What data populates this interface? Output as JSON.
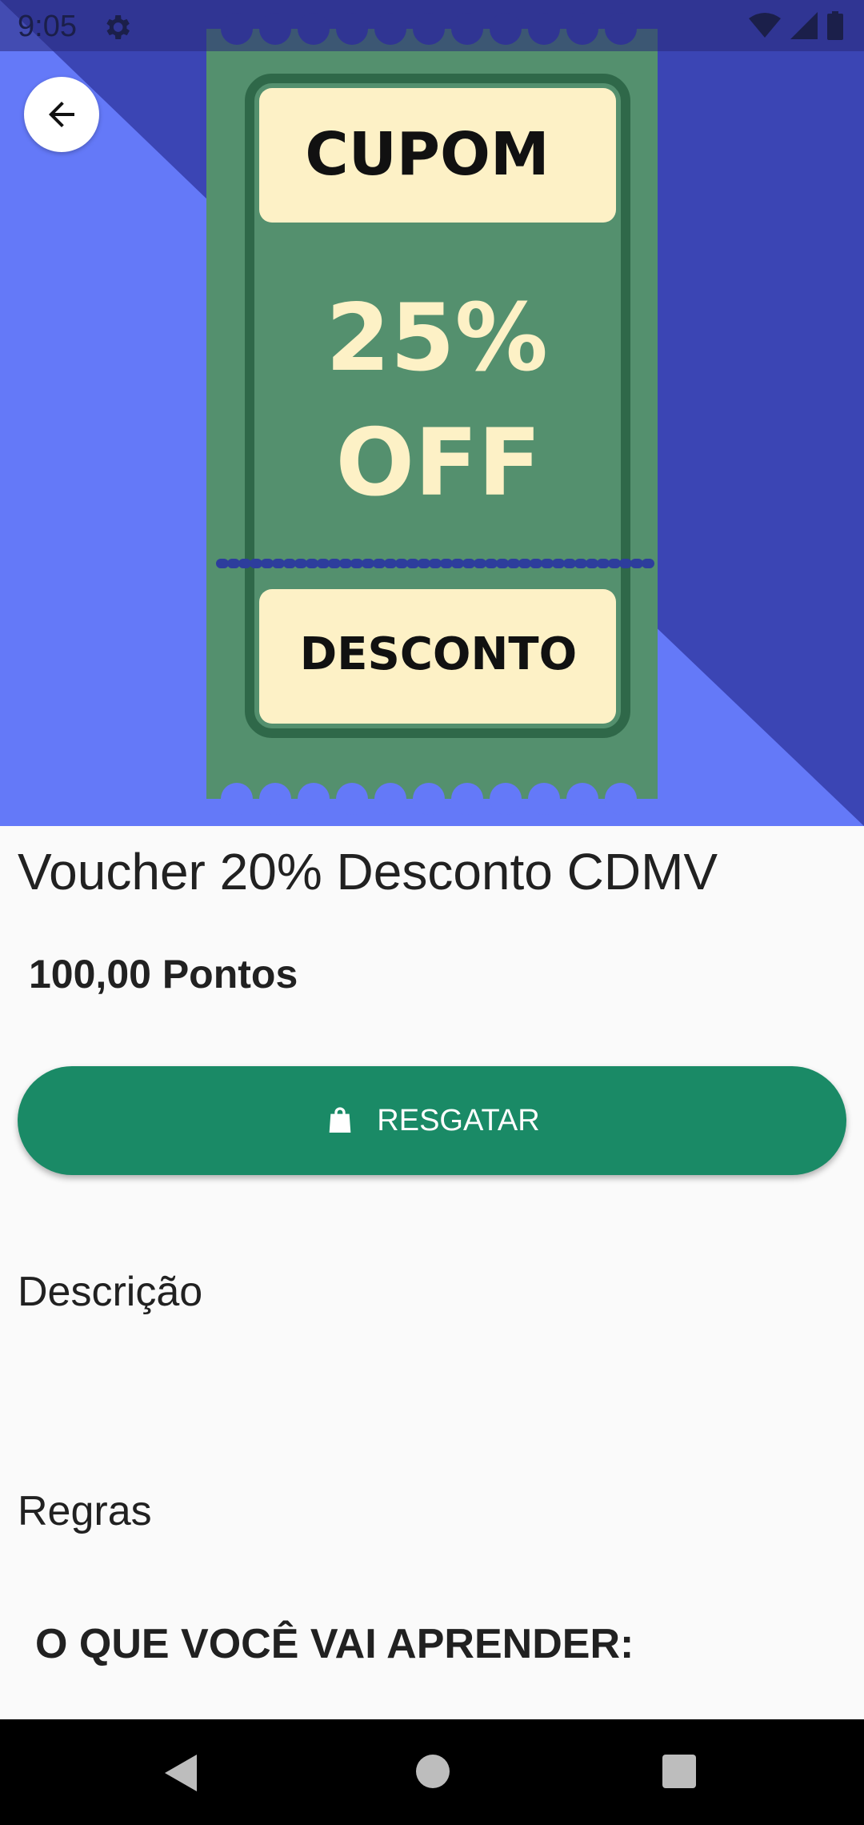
{
  "status_bar": {
    "time": "9:05",
    "icons": [
      "gear-icon",
      "wifi-icon",
      "signal-icon",
      "battery-icon"
    ]
  },
  "hero": {
    "coupon_top": "CUPOM",
    "coupon_percent": "25%",
    "coupon_off": "OFF",
    "coupon_bottom": "DESCONTO",
    "colors": {
      "bg_dark": "#3b45b4",
      "bg_light": "#6479f8",
      "ticket_green": "#54906e",
      "ticket_cream": "#fdf1c6"
    }
  },
  "product": {
    "title": "Voucher 20% Desconto CDMV",
    "points": "100,00 Pontos"
  },
  "redeem_button": {
    "label": "RESGATAR",
    "icon": "shopping-bag-icon",
    "color": "#1a8a66"
  },
  "sections": {
    "description_title": "Descrição",
    "rules_title": "Regras",
    "learn_heading": "O QUE VOCÊ VAI APRENDER:"
  },
  "nav_bar": {
    "icons": [
      "nav-back-icon",
      "nav-home-icon",
      "nav-recent-icon"
    ]
  }
}
